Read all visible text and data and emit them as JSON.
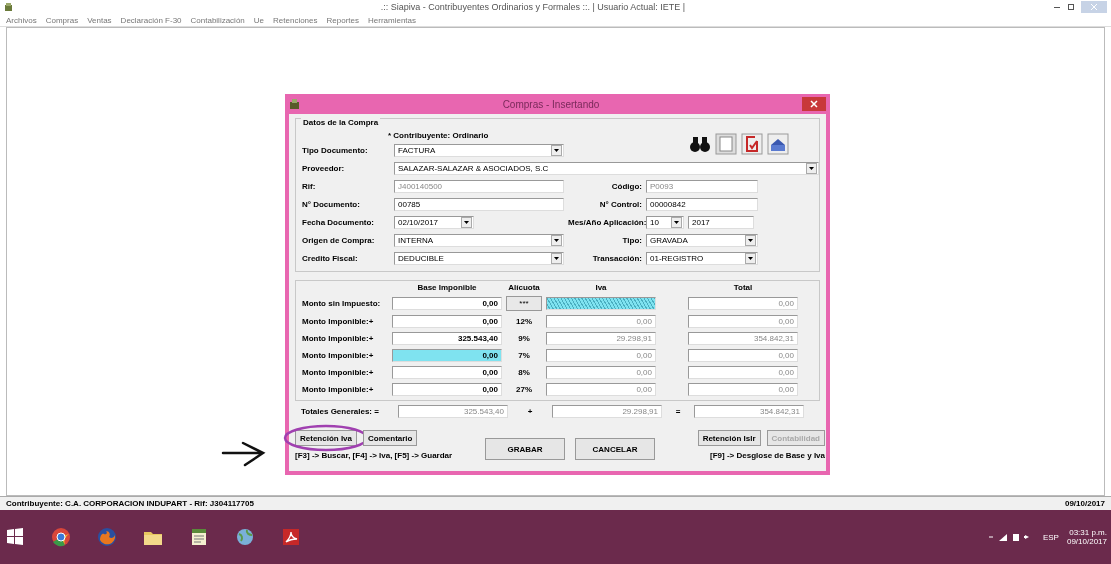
{
  "window": {
    "title": ".:: Siapiva - Contribuyentes Ordinarios y Formales ::. | Usuario Actual: IETE |"
  },
  "menu": [
    "Archivos",
    "Compras",
    "Ventas",
    "Declaración F-30",
    "Contabilización",
    "Ue",
    "Retenciones",
    "Reportes",
    "Herramientas"
  ],
  "dialog": {
    "title": "Compras - Insertando",
    "group_title": "Datos de la Compra",
    "taxpayer_note": "* Contribuyente: Ordinario",
    "rows": [
      [
        {
          "label": "Tipo Documento:",
          "value": "FACTURA",
          "kind": "combo"
        }
      ],
      [
        {
          "label": "Proveedor:",
          "value": "SALAZAR-SALAZAR & ASOCIADOS, S.C",
          "kind": "wide_combo"
        }
      ],
      [
        {
          "label": "Rif:",
          "value": "J400140500",
          "kind": "readonly"
        },
        {
          "label": "Código:",
          "value": "P0093",
          "kind": "readonly"
        }
      ],
      [
        {
          "label": "N° Documento:",
          "value": "00785",
          "kind": "text"
        },
        {
          "label": "N° Control:",
          "value": "00000842",
          "kind": "text"
        }
      ],
      [
        {
          "label": "Fecha Documento:",
          "value": "02/10/2017",
          "kind": "short_combo"
        },
        {
          "label": "Mes/Año Aplicación:",
          "value": "10",
          "year": "2017",
          "kind": "month_year"
        }
      ],
      [
        {
          "label": "Origen de Compra:",
          "value": "INTERNA",
          "kind": "combo"
        },
        {
          "label": "Tipo:",
          "value": "GRAVADA",
          "kind": "combo"
        }
      ],
      [
        {
          "label": "Credito Fiscal:",
          "value": "DEDUCIBLE",
          "kind": "combo"
        },
        {
          "label": "Transacción:",
          "value": "01-REGISTRO",
          "kind": "combo"
        }
      ]
    ],
    "amounts": {
      "columns": [
        "Base Imponible",
        "Alícuota",
        "Iva",
        "Total"
      ],
      "rows": [
        {
          "label": "Monto sin Impuesto:",
          "base": "0,00",
          "rate": {
            "text": "***",
            "kind": "button"
          },
          "iva": {
            "kind": "hatched"
          },
          "total": "0,00",
          "base_selected": false
        },
        {
          "label": "Monto Imponible:+",
          "base": "0,00",
          "rate": {
            "text": "12%",
            "kind": "text"
          },
          "iva": {
            "text": "0,00",
            "kind": "text"
          },
          "total": "0,00",
          "base_selected": false
        },
        {
          "label": "Monto Imponible:+",
          "base": "325.543,40",
          "rate": {
            "text": "9%",
            "kind": "text"
          },
          "iva": {
            "text": "29.298,91",
            "kind": "text"
          },
          "total": "354.842,31",
          "base_selected": false
        },
        {
          "label": "Monto Imponible:+",
          "base": "0,00",
          "rate": {
            "text": "7%",
            "kind": "text"
          },
          "iva": {
            "text": "0,00",
            "kind": "text"
          },
          "total": "0,00",
          "base_selected": true
        },
        {
          "label": "Monto Imponible:+",
          "base": "0,00",
          "rate": {
            "text": "8%",
            "kind": "text"
          },
          "iva": {
            "text": "0,00",
            "kind": "text"
          },
          "total": "0,00",
          "base_selected": false
        },
        {
          "label": "Monto Imponible:+",
          "base": "0,00",
          "rate": {
            "text": "27%",
            "kind": "text"
          },
          "iva": {
            "text": "0,00",
            "kind": "text"
          },
          "total": "0,00",
          "base_selected": false
        }
      ],
      "totals": {
        "label": "Totales Generales: =",
        "base": "325.543,40",
        "plus": "+",
        "iva": "29.298,91",
        "equals": "=",
        "total": "354.842,31"
      }
    },
    "left_buttons": [
      {
        "label": "Retención Iva",
        "disabled": false,
        "circled": true
      },
      {
        "label": "Comentario",
        "disabled": false,
        "circled": false
      }
    ],
    "center_buttons": [
      {
        "label": "GRABAR",
        "disabled": false
      },
      {
        "label": "CANCELAR",
        "disabled": false
      }
    ],
    "right_buttons": [
      {
        "label": "Retención Islr",
        "disabled": false
      },
      {
        "label": "Contabilidad",
        "disabled": true
      }
    ],
    "left_hint": "[F3] -> Buscar, [F4] -> Iva, [F5] -> Guardar",
    "right_hint": "[F9] -> Desglose de Base y Iva"
  },
  "status_bar": {
    "taxpayer": "Contribuyente: C.A. CORPORACION INDUPART - Rif: J304117705",
    "date": "09/10/2017"
  },
  "taskbar": {
    "language": "ESP",
    "time": "03:31 p.m.",
    "date": "09/10/2017"
  }
}
